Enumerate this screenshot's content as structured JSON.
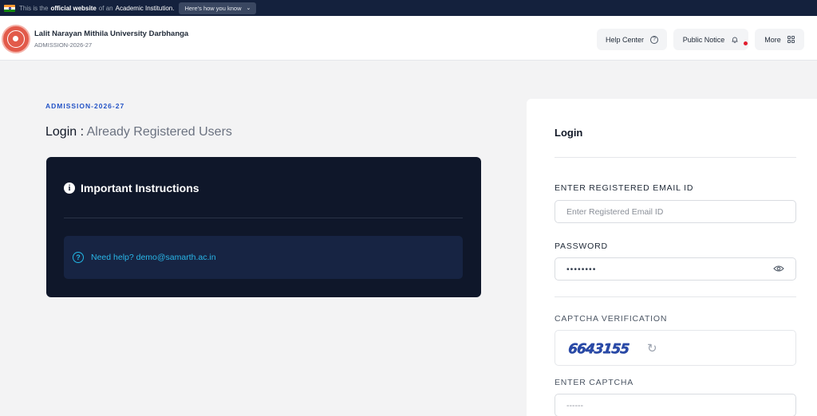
{
  "gov_bar": {
    "prefix": "This is the",
    "highlight": "official website",
    "middle": "of an",
    "institution": "Academic Institution.",
    "how_button": "Here's how you know"
  },
  "header": {
    "university_name": "Lalit Narayan Mithila University Darbhanga",
    "subtitle": "ADMISSION-2026-27",
    "help_center": "Help Center",
    "public_notice": "Public Notice",
    "more": "More"
  },
  "main": {
    "admission_label": "ADMISSION-2026-27",
    "heading_prefix": "Login :",
    "heading_rest": "Already Registered Users",
    "instructions_title": "Important Instructions",
    "help_text": "Need help? demo@samarth.ac.in"
  },
  "login_panel": {
    "title": "Login",
    "email_label": "ENTER REGISTERED EMAIL ID",
    "email_placeholder": "Enter Registered Email ID",
    "password_label": "PASSWORD",
    "password_value": "••••••••",
    "captcha_label": "CAPTCHA VERIFICATION",
    "captcha_text": "6643155",
    "enter_captcha_label": "ENTER CAPTCHA",
    "captcha_input_placeholder": "------"
  },
  "colors": {
    "gov_bar_bg": "#14213d",
    "instructions_bg": "#0f172a",
    "accent_blue": "#2353c6",
    "help_text": "#29b6e8",
    "notification_dot": "#e11d2e"
  },
  "icons": {
    "flag": "india-flag-icon",
    "info": "info-icon",
    "help": "question-circle-icon",
    "bell": "bell-icon",
    "grid": "grid-icon",
    "eye": "eye-icon",
    "refresh": "refresh-icon"
  }
}
